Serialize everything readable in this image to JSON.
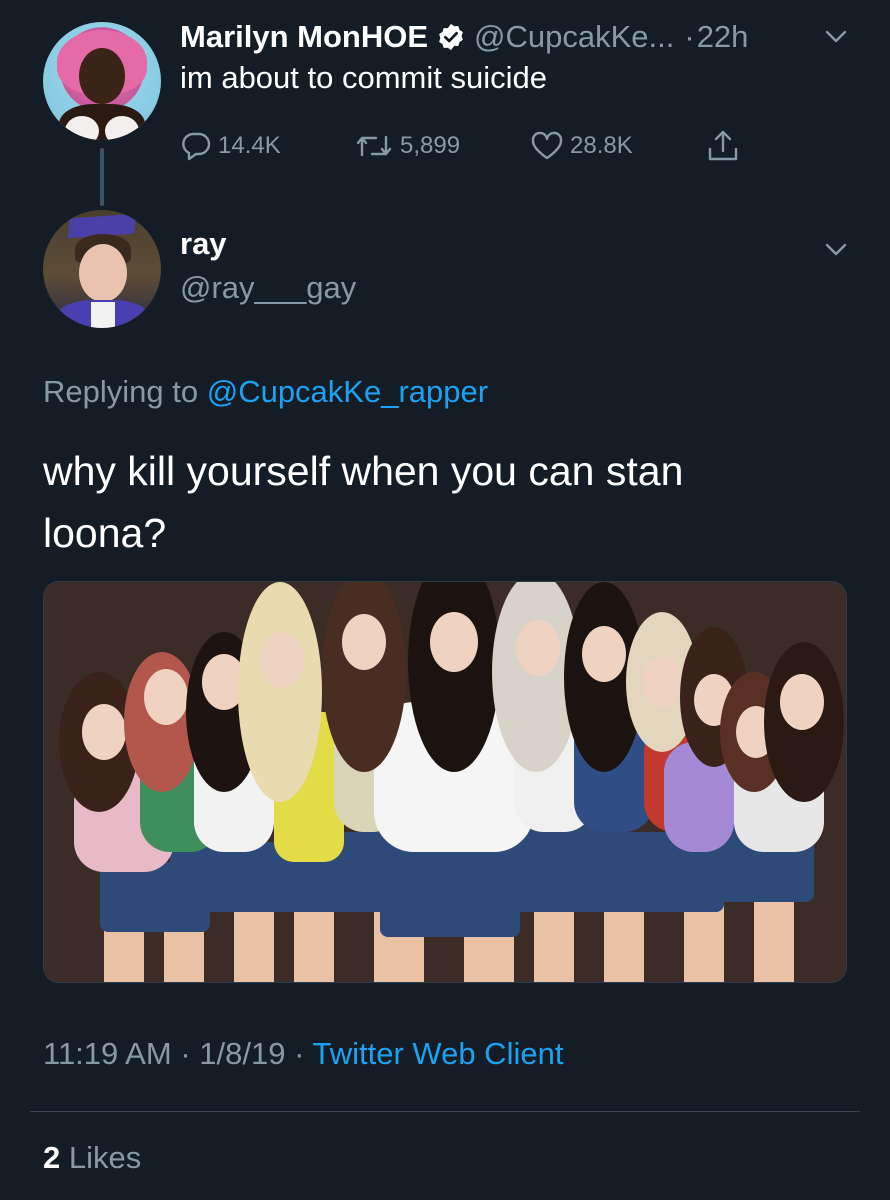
{
  "parent_tweet": {
    "display_name": "Marilyn MonHOE",
    "handle": "@CupcakKe...",
    "time": "22h",
    "separator": "·",
    "text": "im about to commit suicide",
    "actions": {
      "replies": "14.4K",
      "retweets": "5,899",
      "likes": "28.8K"
    }
  },
  "reply_tweet": {
    "display_name": "ray",
    "handle": "@ray___gay",
    "replying_prefix": "Replying to",
    "replying_to": "@CupcakKe_rapper",
    "text": "why kill yourself when you can stan loona?",
    "timestamp": "11:19 AM",
    "date": "1/8/19",
    "separator": "·",
    "client": "Twitter Web Client",
    "likes_count": "2",
    "likes_label": "Likes"
  },
  "colors": {
    "background": "#141d26",
    "secondary_text": "#8899a6",
    "link": "#1da1f2",
    "verified": "#ffffff"
  },
  "icons": [
    "verified-icon",
    "chevron-down-icon",
    "reply-icon",
    "retweet-icon",
    "like-icon",
    "share-icon"
  ]
}
